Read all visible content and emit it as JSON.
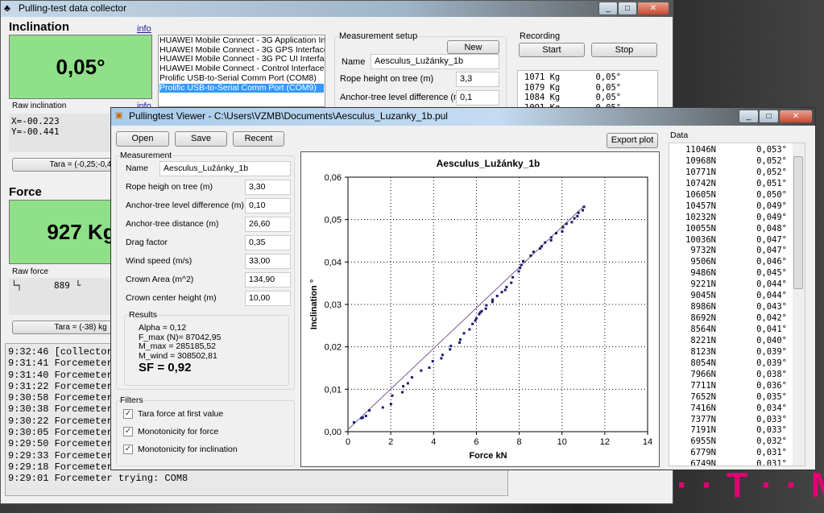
{
  "collector": {
    "title": "Pulling-test data collector",
    "inclination_label": "Inclination",
    "info_label": "info",
    "inclination_value": "0,05°",
    "raw_inclination_label": "Raw inclination",
    "raw_inclination_lines": [
      "X=-00.223",
      "Y=-00.441"
    ],
    "tara_inclination_label": "Tara = (-0,25;-0,4",
    "force_label": "Force",
    "force_value": "927 Kg",
    "raw_force_label": "Raw force",
    "raw_force_text": "└┐      889 └",
    "tara_force_label": "Tara = (-38) kg",
    "ports": [
      "HUAWEI Mobile Connect - 3G Application Interf.",
      "HUAWEI Mobile Connect - 3G GPS Interface (C",
      "HUAWEI Mobile Connect - 3G PC UI Interface (",
      "HUAWEI Mobile Connect - Control Interface (CC",
      "Prolific USB-to-Serial Comm Port (COM8)",
      "Prolific USB-to-Serial Comm Port (COM9)"
    ],
    "selected_port": 5,
    "setup": {
      "group_label": "Measurement setup",
      "new_label": "New",
      "name_label": "Name",
      "name_value": "Aesculus_Lužánky_1b",
      "rope_label": "Rope height on tree (m)",
      "rope_value": "3,3",
      "anchor_label": "Anchor-tree level difference (m)",
      "anchor_value": "0,1"
    },
    "recording": {
      "group_label": "Recording",
      "start_label": "Start",
      "stop_label": "Stop",
      "rows": [
        "1071 Kg       0,05°",
        "1079 Kg       0,05°",
        "1084 Kg       0,05°",
        "1091 Kg       0,05°"
      ]
    },
    "log": [
      "9:32:46 [collector",
      "9:31:41 Forcemeter",
      "9:31:40 Forcemeter",
      "9:31:22 Forcemeter",
      "9:30:58 Forcemeter",
      "9:30:38 Forcemeter",
      "9:30:22 Forcemeter",
      "9:30:05 Forcemeter",
      "9:29:50 Forcemeter",
      "9:29:33 Forcemeter",
      "9:29:18 Forcemeter",
      "9:29:01 Forcemeter trying: COM8"
    ]
  },
  "viewer": {
    "title": "Pullingtest Viewer - C:\\Users\\VZMB\\Documents\\Aesculus_Luzanky_1b.pul",
    "open_label": "Open",
    "save_label": "Save",
    "recent_label": "Recent",
    "export_label": "Export plot",
    "measurement_label": "Measurement",
    "fields": [
      {
        "label": "Name",
        "value": "Aesculus_Lužánky_1b"
      },
      {
        "label": "Rope heigh on tree (m)",
        "value": "3,30"
      },
      {
        "label": "Anchor-tree level difference (m)",
        "value": "0,10"
      },
      {
        "label": "Anchor-tree distance (m)",
        "value": "26,60"
      },
      {
        "label": "Drag factor",
        "value": "0,35"
      },
      {
        "label": "Wind speed (m/s)",
        "value": "33,00"
      },
      {
        "label": "Crown Area (m^2)",
        "value": "134,90"
      },
      {
        "label": "Crown center height (m)",
        "value": "10,00"
      }
    ],
    "results_label": "Results",
    "results": [
      "Alpha = 0,12",
      "F_max (N)= 87042,95",
      "M_max = 285185,52",
      "M_wind = 308502,81"
    ],
    "sf": "SF = 0,92",
    "filters_label": "Filters",
    "filters": [
      {
        "label": "Tara force at first value",
        "checked": true
      },
      {
        "label": "Monotonicity for force",
        "checked": true
      },
      {
        "label": "Monotonicity for inclination",
        "checked": true
      }
    ],
    "data_label": "Data",
    "data_rows": [
      [
        "11046N",
        "0,053°"
      ],
      [
        "10968N",
        "0,052°"
      ],
      [
        "10771N",
        "0,052°"
      ],
      [
        "10742N",
        "0,051°"
      ],
      [
        "10605N",
        "0,050°"
      ],
      [
        "10457N",
        "0,049°"
      ],
      [
        "10232N",
        "0,049°"
      ],
      [
        "10055N",
        "0,048°"
      ],
      [
        "10036N",
        "0,047°"
      ],
      [
        "9732N",
        "0,047°"
      ],
      [
        "9506N",
        "0,046°"
      ],
      [
        "9486N",
        "0,045°"
      ],
      [
        "9221N",
        "0,044°"
      ],
      [
        "9045N",
        "0,044°"
      ],
      [
        "8986N",
        "0,043°"
      ],
      [
        "8692N",
        "0,042°"
      ],
      [
        "8564N",
        "0,041°"
      ],
      [
        "8221N",
        "0,040°"
      ],
      [
        "8123N",
        "0,039°"
      ],
      [
        "8054N",
        "0,039°"
      ],
      [
        "7966N",
        "0,038°"
      ],
      [
        "7711N",
        "0,036°"
      ],
      [
        "7652N",
        "0,035°"
      ],
      [
        "7416N",
        "0,034°"
      ],
      [
        "7377N",
        "0,033°"
      ],
      [
        "7191N",
        "0,033°"
      ],
      [
        "6955N",
        "0,032°"
      ],
      [
        "6779N",
        "0,031°"
      ],
      [
        "6749N",
        "0,031°"
      ]
    ]
  },
  "desktop": {
    "logo_text": "· · T · · Mo"
  },
  "colors": {
    "green_display": "#90e08a",
    "selection": "#3399ff",
    "points": "#1a1a6e",
    "fit_line": "#7a5a8a",
    "logo": "#e20074"
  },
  "chart_data": {
    "type": "scatter",
    "title": "Aesculus_Lužánky_1b",
    "xlabel": "Force  kN",
    "ylabel": "Inclination °",
    "xlim": [
      0,
      14
    ],
    "ylim": [
      0,
      0.06
    ],
    "grid": true,
    "xticks": [
      "0",
      "2",
      "4",
      "6",
      "8",
      "10",
      "12",
      "14"
    ],
    "yticks": [
      "0,00",
      "0,01",
      "0,02",
      "0,03",
      "0,04",
      "0,05",
      "0,06"
    ],
    "points": [
      [
        0.28,
        0.0022
      ],
      [
        0.63,
        0.0032
      ],
      [
        0.69,
        0.0033
      ],
      [
        0.84,
        0.0037
      ],
      [
        1.0,
        0.005
      ],
      [
        1.63,
        0.0057
      ],
      [
        2.01,
        0.0065
      ],
      [
        2.07,
        0.0085
      ],
      [
        2.54,
        0.0093
      ],
      [
        2.58,
        0.0107
      ],
      [
        2.8,
        0.0114
      ],
      [
        2.99,
        0.0128
      ],
      [
        3.42,
        0.0144
      ],
      [
        3.8,
        0.0151
      ],
      [
        3.96,
        0.0166
      ],
      [
        4.36,
        0.0173
      ],
      [
        4.42,
        0.0181
      ],
      [
        4.77,
        0.0194
      ],
      [
        4.81,
        0.0202
      ],
      [
        5.21,
        0.021
      ],
      [
        5.25,
        0.0217
      ],
      [
        5.42,
        0.0232
      ],
      [
        5.68,
        0.0241
      ],
      [
        5.82,
        0.0254
      ],
      [
        5.95,
        0.0262
      ],
      [
        6.0,
        0.0267
      ],
      [
        6.13,
        0.0277
      ],
      [
        6.18,
        0.0281
      ],
      [
        6.25,
        0.0284
      ],
      [
        6.44,
        0.029
      ],
      [
        6.47,
        0.0298
      ],
      [
        6.75,
        0.0306
      ],
      [
        6.76,
        0.0311
      ],
      [
        6.97,
        0.032
      ],
      [
        7.19,
        0.0329
      ],
      [
        7.35,
        0.0334
      ],
      [
        7.41,
        0.0341
      ],
      [
        7.63,
        0.0351
      ],
      [
        7.7,
        0.0364
      ],
      [
        7.98,
        0.0378
      ],
      [
        8.04,
        0.0386
      ],
      [
        8.1,
        0.0393
      ],
      [
        8.19,
        0.0402
      ],
      [
        8.54,
        0.0415
      ],
      [
        8.67,
        0.0424
      ],
      [
        8.98,
        0.0432
      ],
      [
        9.05,
        0.0437
      ],
      [
        9.21,
        0.0446
      ],
      [
        9.49,
        0.0451
      ],
      [
        9.5,
        0.0458
      ],
      [
        9.73,
        0.0468
      ],
      [
        10.01,
        0.0472
      ],
      [
        10.05,
        0.0482
      ],
      [
        10.21,
        0.049
      ],
      [
        10.46,
        0.0494
      ],
      [
        10.58,
        0.0503
      ],
      [
        10.72,
        0.0508
      ],
      [
        10.77,
        0.0516
      ],
      [
        10.97,
        0.0522
      ],
      [
        11.03,
        0.053
      ]
    ],
    "fit_line": [
      [
        0,
        0.0005
      ],
      [
        11.05,
        0.0533
      ]
    ]
  }
}
